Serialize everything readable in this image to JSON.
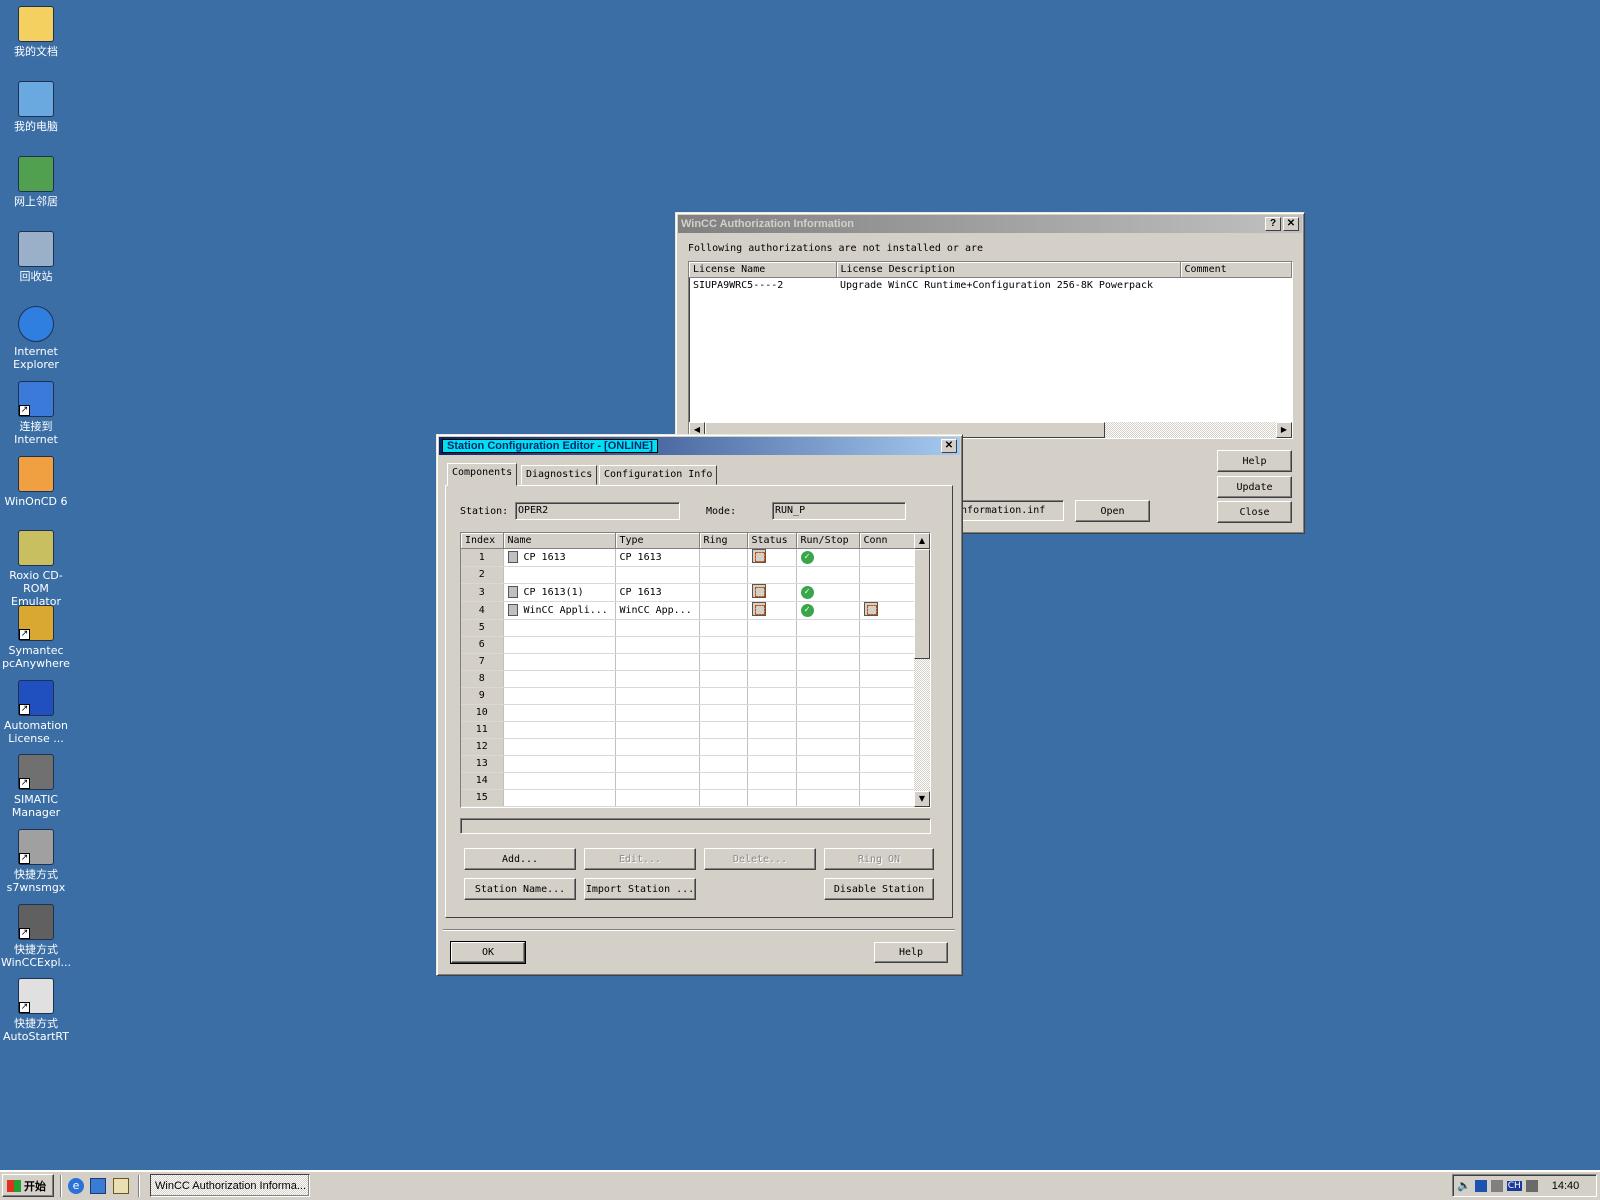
{
  "desktop": {
    "icons": [
      {
        "label": "我的文档",
        "icon": "folder-docs-icon"
      },
      {
        "label": "我的电脑",
        "icon": "computer-icon"
      },
      {
        "label": "网上邻居",
        "icon": "network-icon"
      },
      {
        "label": "回收站",
        "icon": "recycle-bin-icon"
      },
      {
        "label": "Internet Explorer",
        "icon": "ie-icon"
      },
      {
        "label": "连接到 Internet",
        "icon": "connect-icon"
      },
      {
        "label": "WinOnCD 6",
        "icon": "winoncd-icon"
      },
      {
        "label": "Roxio CD-ROM Emulator",
        "icon": "cdrom-icon"
      },
      {
        "label": "Symantec pcAnywhere",
        "icon": "pcanywhere-icon"
      },
      {
        "label": "Automation License ...",
        "icon": "license-icon"
      },
      {
        "label": "SIMATIC Manager",
        "icon": "simatic-icon"
      },
      {
        "label": "快捷方式 s7wnsmgx",
        "icon": "shortcut-icon"
      },
      {
        "label": "快捷方式 WinCCExpl...",
        "icon": "shortcut-icon"
      },
      {
        "label": "快捷方式 AutoStartRT",
        "icon": "shortcut-icon"
      }
    ]
  },
  "auth_window": {
    "title": "WinCC Authorization Information",
    "help_glyph": "?",
    "close_glyph": "✕",
    "message": "Following authorizations are not installed or are",
    "columns": [
      "License Name",
      "License Description",
      "Comment"
    ],
    "rows": [
      {
        "name": "SIUPA9WRC5----2",
        "description": "Upgrade WinCC Runtime+Configuration 256-8K Powerpack",
        "comment": ""
      }
    ],
    "file_field": "rinformation.inf",
    "buttons": {
      "open": "Open",
      "help": "Help",
      "update": "Update",
      "close": "Close"
    }
  },
  "station_window": {
    "title": "Station Configuration Editor - [ONLINE]",
    "close_glyph": "✕",
    "tabs": [
      "Components",
      "Diagnostics",
      "Configuration Info"
    ],
    "station_label": "Station:",
    "station_value": "OPER2",
    "mode_label": "Mode:",
    "mode_value": "RUN_P",
    "columns": [
      "Index",
      "Name",
      "Type",
      "Ring",
      "Status",
      "Run/Stop",
      "Conn"
    ],
    "rows": [
      {
        "index": "1",
        "name": "CP 1613",
        "type": "CP 1613",
        "status": true,
        "run": true,
        "conn": false
      },
      {
        "index": "2",
        "name": "",
        "type": "",
        "status": false,
        "run": false,
        "conn": false
      },
      {
        "index": "3",
        "name": "CP 1613(1)",
        "type": "CP 1613",
        "status": true,
        "run": true,
        "conn": false
      },
      {
        "index": "4",
        "name": "WinCC Appli...",
        "type": "WinCC App...",
        "status": true,
        "run": true,
        "conn": true
      },
      {
        "index": "5",
        "name": "",
        "type": ""
      },
      {
        "index": "6",
        "name": "",
        "type": ""
      },
      {
        "index": "7",
        "name": "",
        "type": ""
      },
      {
        "index": "8",
        "name": "",
        "type": ""
      },
      {
        "index": "9",
        "name": "",
        "type": ""
      },
      {
        "index": "10",
        "name": "",
        "type": ""
      },
      {
        "index": "11",
        "name": "",
        "type": ""
      },
      {
        "index": "12",
        "name": "",
        "type": ""
      },
      {
        "index": "13",
        "name": "",
        "type": ""
      },
      {
        "index": "14",
        "name": "",
        "type": ""
      },
      {
        "index": "15",
        "name": "",
        "type": ""
      }
    ],
    "buttons": {
      "add": "Add...",
      "edit": "Edit...",
      "delete": "Delete...",
      "ring_on": "Ring ON",
      "station_name": "Station Name...",
      "import_station": "Import Station ...",
      "disable_station": "Disable Station",
      "ok": "OK",
      "help": "Help"
    }
  },
  "taskbar": {
    "start_label": "开始",
    "task_label": "WinCC Authorization Informa...",
    "lang": "CH",
    "clock": "14:40"
  }
}
